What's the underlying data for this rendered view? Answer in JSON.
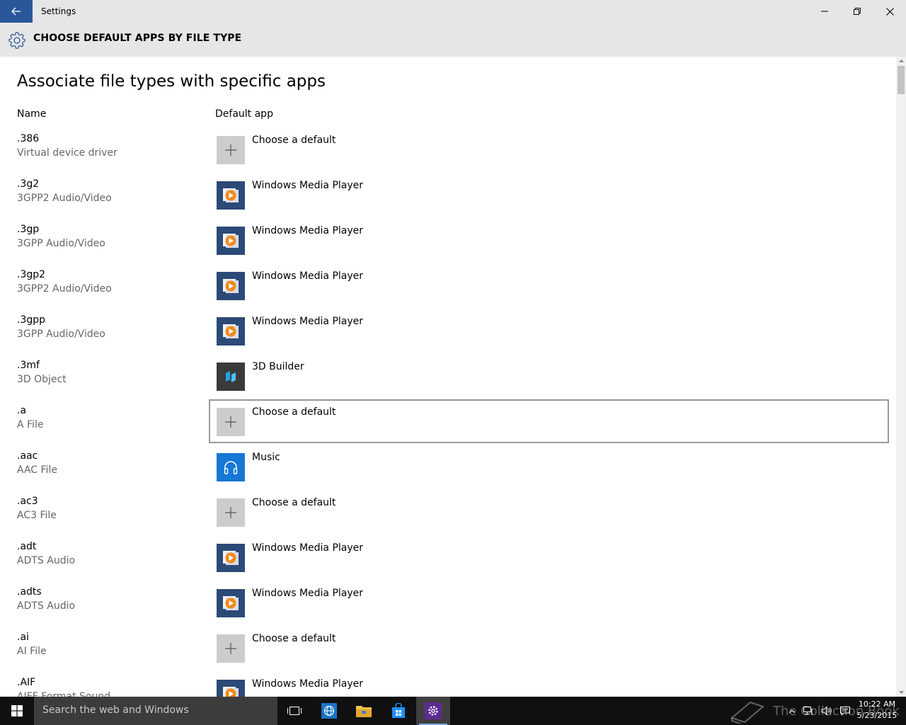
{
  "window": {
    "title": "Settings"
  },
  "header": {
    "title": "CHOOSE DEFAULT APPS BY FILE TYPE"
  },
  "page": {
    "heading": "Associate file types with specific apps",
    "col_name": "Name",
    "col_default": "Default app"
  },
  "rows": [
    {
      "ext": ".386",
      "desc": "Virtual device driver",
      "app": "Choose a default",
      "icon": "plus-icon"
    },
    {
      "ext": ".3g2",
      "desc": "3GPP2 Audio/Video",
      "app": "Windows Media Player",
      "icon": "windows-media-player-icon"
    },
    {
      "ext": ".3gp",
      "desc": "3GPP Audio/Video",
      "app": "Windows Media Player",
      "icon": "windows-media-player-icon"
    },
    {
      "ext": ".3gp2",
      "desc": "3GPP2 Audio/Video",
      "app": "Windows Media Player",
      "icon": "windows-media-player-icon"
    },
    {
      "ext": ".3gpp",
      "desc": "3GPP Audio/Video",
      "app": "Windows Media Player",
      "icon": "windows-media-player-icon"
    },
    {
      "ext": ".3mf",
      "desc": "3D Object",
      "app": "3D Builder",
      "icon": "3d-builder-icon"
    },
    {
      "ext": ".a",
      "desc": "A File",
      "app": "Choose a default",
      "icon": "plus-icon"
    },
    {
      "ext": ".aac",
      "desc": "AAC File",
      "app": "Music",
      "icon": "music-headphones-icon"
    },
    {
      "ext": ".ac3",
      "desc": "AC3 File",
      "app": "Choose a default",
      "icon": "plus-icon"
    },
    {
      "ext": ".adt",
      "desc": "ADTS Audio",
      "app": "Windows Media Player",
      "icon": "windows-media-player-icon"
    },
    {
      "ext": ".adts",
      "desc": "ADTS Audio",
      "app": "Windows Media Player",
      "icon": "windows-media-player-icon"
    },
    {
      "ext": ".ai",
      "desc": "AI File",
      "app": "Choose a default",
      "icon": "plus-icon"
    },
    {
      "ext": ".AIF",
      "desc": "AIFF Format Sound",
      "app": "Windows Media Player",
      "icon": "windows-media-player-icon"
    }
  ],
  "taskbar": {
    "search_placeholder": "Search the web and Windows",
    "time": "10:22 AM",
    "date": "5/23/2015",
    "watermark": "The Collection Book"
  },
  "colors": {
    "accent": "#2b579a",
    "chrome": "#e6e6e6",
    "taskbar": "#101010",
    "focus_border": "#999999"
  }
}
